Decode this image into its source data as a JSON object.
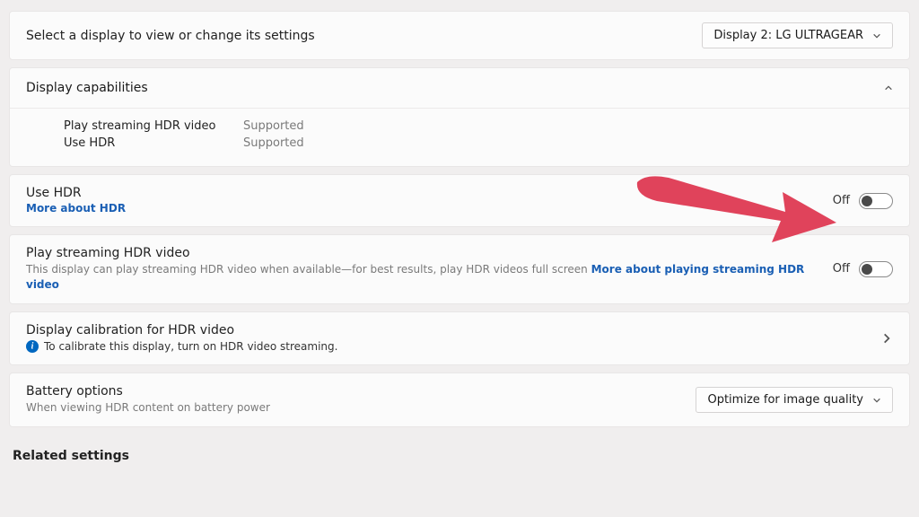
{
  "selector": {
    "label": "Select a display to view or change its settings",
    "value": "Display 2: LG ULTRAGEAR"
  },
  "capabilities": {
    "title": "Display capabilities",
    "rows": [
      {
        "key": "Play streaming HDR video",
        "value": "Supported"
      },
      {
        "key": "Use HDR",
        "value": "Supported"
      }
    ]
  },
  "useHdr": {
    "title": "Use HDR",
    "link": "More about HDR",
    "state": "Off"
  },
  "streaming": {
    "title": "Play streaming HDR video",
    "sub": "This display can play streaming HDR video when available—for best results, play HDR videos full screen",
    "link": "More about playing streaming HDR video",
    "state": "Off"
  },
  "calibration": {
    "title": "Display calibration for HDR video",
    "hint": "To calibrate this display, turn on HDR video streaming."
  },
  "battery": {
    "title": "Battery options",
    "sub": "When viewing HDR content on battery power",
    "value": "Optimize for image quality"
  },
  "related": "Related settings"
}
